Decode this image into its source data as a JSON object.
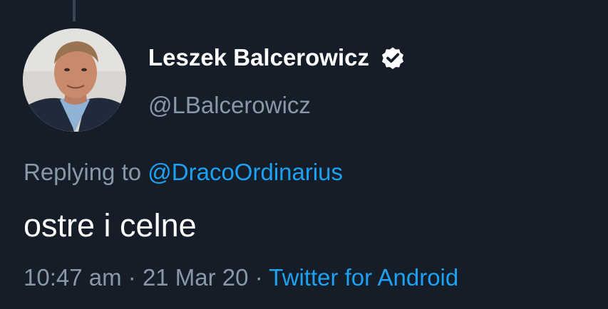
{
  "tweet": {
    "author": {
      "display_name": "Leszek Balcerowicz",
      "handle": "@LBalcerowicz",
      "verified": true,
      "avatar_icon": "user-avatar-photo"
    },
    "reply": {
      "prefix": "Replying to",
      "mention": "@DracoOrdinarius"
    },
    "text": "ostre i celne",
    "time": "10:47 am",
    "separator": "·",
    "date": "21 Mar 20",
    "source": "Twitter for Android"
  },
  "colors": {
    "background": "#151d28",
    "primary_text": "#ffffff",
    "secondary_text": "#8899a6",
    "accent": "#1da1f2"
  }
}
